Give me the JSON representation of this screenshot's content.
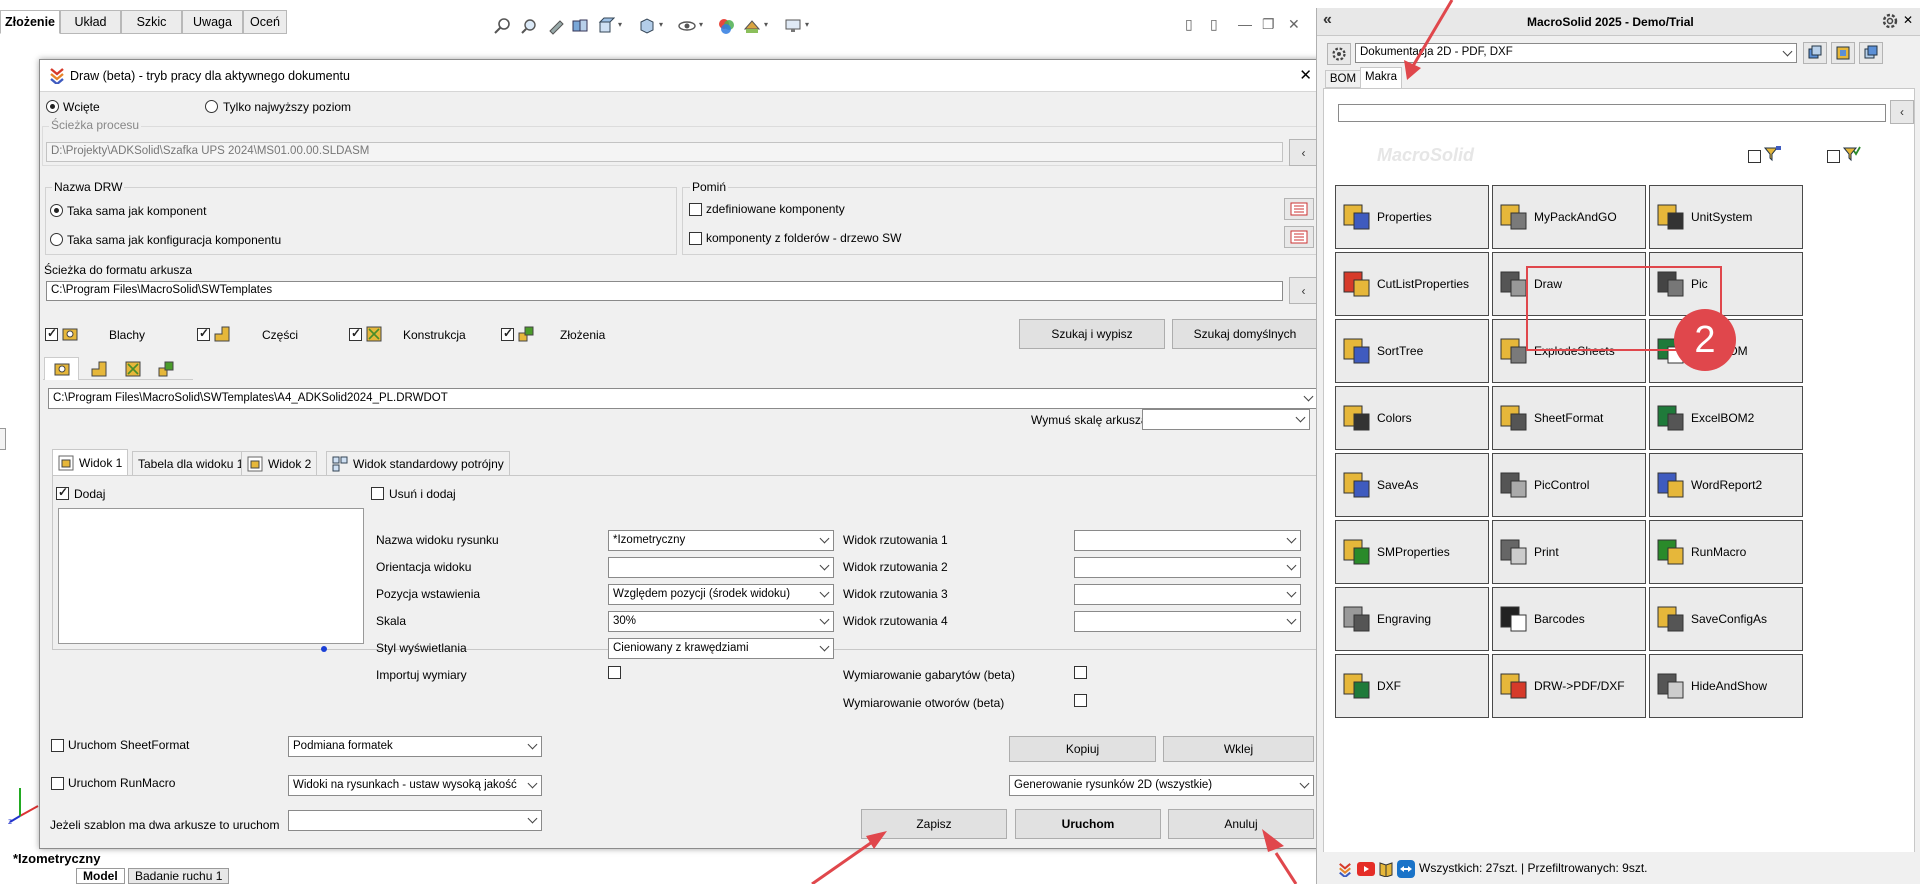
{
  "app": {
    "command_tabs": [
      "Złożenie",
      "Układ",
      "Szkic",
      "Uwaga",
      "Oceń"
    ],
    "active_tab": "Złożenie",
    "view_name": "*Izometryczny",
    "bottom_tabs": [
      "Model",
      "Badanie ruchu 1"
    ]
  },
  "dialog": {
    "title": "Draw (beta) - tryb pracy dla aktywnego dokumentu",
    "close": "✕",
    "mode_options": [
      "Wcięte",
      "Tylko najwyższy poziom"
    ],
    "process_path_label": "Ścieżka procesu",
    "process_path": "D:\\Projekty\\ADKSolid\\Szafka UPS 2024\\MS01.00.00.SLDASM",
    "drw_name_group": "Nazwa DRW",
    "drw_name_options": [
      "Taka sama jak komponent",
      "Taka sama jak konfiguracja komponentu"
    ],
    "skip_group": "Pomiń",
    "skip_options": [
      "zdefiniowane komponenty",
      "komponenty z folderów - drzewo SW"
    ],
    "sheet_format_label": "Ścieżka do formatu arkusza",
    "sheet_format_path": "C:\\Program Files\\MacroSolid\\SWTemplates",
    "types": [
      "Blachy",
      "Części",
      "Konstrukcja",
      "Złożenia"
    ],
    "search_button": "Szukaj i wypisz",
    "search_default_button": "Szukaj domyślnych",
    "template_path": "C:\\Program Files\\MacroSolid\\SWTemplates\\A4_ADKSolid2024_PL.DRWDOT",
    "force_scale_label": "Wymuś skalę arkusza",
    "force_scale_value": "",
    "tabs": [
      "Widok 1",
      "Tabela dla widoku 1",
      "Widok 2",
      "Widok standardowy potrójny"
    ],
    "add_label": "Dodaj",
    "remove_add_label": "Usuń i dodaj",
    "view_fields": [
      {
        "label": "Nazwa widoku rysunku",
        "value": "*Izometryczny"
      },
      {
        "label": "Orientacja widoku",
        "value": ""
      },
      {
        "label": "Pozycja wstawienia",
        "value": "Względem pozycji (środek widoku)"
      },
      {
        "label": "Skala",
        "value": "30%"
      },
      {
        "label": "Styl wyświetlania",
        "value": "Cieniowany z krawędziami"
      },
      {
        "label": "Importuj wymiary",
        "value": ""
      }
    ],
    "projection_fields": [
      {
        "label": "Widok rzutowania 1",
        "value": ""
      },
      {
        "label": "Widok rzutowania 2",
        "value": ""
      },
      {
        "label": "Widok rzutowania 3",
        "value": ""
      },
      {
        "label": "Widok rzutowania 4",
        "value": ""
      }
    ],
    "dimension_options": [
      "Wymiarowanie gabarytów (beta)",
      "Wymiarowanie otworów (beta)"
    ],
    "run_sheetformat_label": "Uruchom SheetFormat",
    "run_sheetformat_value": "Podmiana formatek",
    "run_runmacro_label": "Uruchom RunMacro",
    "run_runmacro_value": "Widoki na rysunkach - ustaw wysoką jakość",
    "two_sheets_label": "Jeżeli szablon ma dwa arkusze to uruchom",
    "two_sheets_value": "",
    "copy_button": "Kopiuj",
    "paste_button": "Wklej",
    "generate_value": "Generowanie rysunków 2D (wszystkie)",
    "save_button": "Zapisz",
    "run_button": "Uruchom",
    "cancel_button": "Anuluj"
  },
  "panel": {
    "title": "MacroSolid 2025 - Demo/Trial",
    "collapse": "«",
    "preset": "Dokumentacja 2D - PDF, DXF",
    "tabs": [
      "BOM",
      "Makra"
    ],
    "active_tab": "Makra",
    "search_value": "",
    "search_back": "‹",
    "logo": "MacroSolid",
    "macros": [
      "Properties",
      "MyPackAndGO",
      "UnitSystem",
      "CutListProperties",
      "Draw",
      "Pic",
      "SortTree",
      "ExplodeSheets",
      "ExcelBOM",
      "Colors",
      "SheetFormat",
      "ExcelBOM2",
      "SaveAs",
      "PicControl",
      "WordReport2",
      "SMProperties",
      "Print",
      "RunMacro",
      "Engraving",
      "Barcodes",
      "SaveConfigAs",
      "DXF",
      "DRW->PDF/DXF",
      "HideAndShow"
    ],
    "status": "Wszystkich: 27szt. | Przefiltrowanych: 9szt."
  },
  "annotation": {
    "step_number": "2",
    "highlight_color": "#e0474c",
    "arrow_color": "#e0474c"
  }
}
